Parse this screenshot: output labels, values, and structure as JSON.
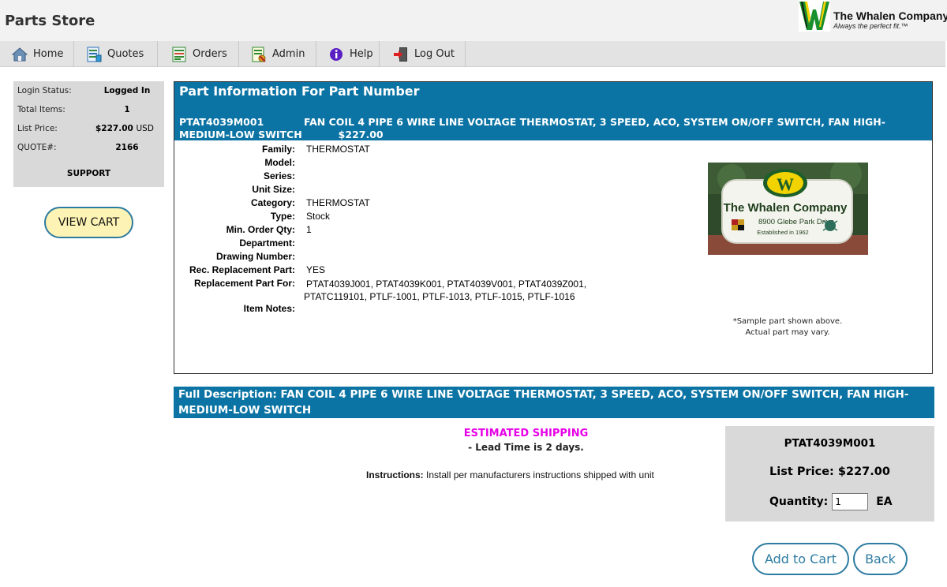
{
  "header": {
    "app_title": "Parts Store",
    "logo_name": "The Whalen Company",
    "logo_tagline": "Always the perfect fit.™",
    "logo_letter": "W"
  },
  "nav": {
    "items": [
      {
        "label": "Home",
        "icon": "home-icon"
      },
      {
        "label": "Quotes",
        "icon": "quotes-icon"
      },
      {
        "label": "Orders",
        "icon": "orders-icon"
      },
      {
        "label": "Admin",
        "icon": "admin-icon"
      },
      {
        "label": "Help",
        "icon": "help-icon"
      },
      {
        "label": "Log Out",
        "icon": "logout-icon"
      }
    ]
  },
  "sidebar": {
    "login_status_label": "Login Status:",
    "login_status_value": "Logged In",
    "total_items_label": "Total Items:",
    "total_items_value": "1",
    "list_price_label": "List Price:",
    "list_price_value": "$227.00",
    "list_price_currency": "USD",
    "quote_label": "QUOTE#:",
    "quote_value": "2166",
    "support_label": "SUPPORT",
    "view_cart_label": "VIEW CART"
  },
  "part": {
    "panel_title": "Part Information For Part Number",
    "part_number": "PTAT4039M001",
    "description": "FAN COIL 4 PIPE 6 WIRE LINE VOLTAGE THERMOSTAT, 3 SPEED, ACO, SYSTEM ON/OFF SWITCH, FAN HIGH-MEDIUM-LOW SWITCH",
    "price": "$227.00",
    "fields": [
      {
        "label": "Family:",
        "value": "THERMOSTAT"
      },
      {
        "label": "Model:",
        "value": ""
      },
      {
        "label": "Series:",
        "value": ""
      },
      {
        "label": "Unit Size:",
        "value": ""
      },
      {
        "label": "Category:",
        "value": "THERMOSTAT"
      },
      {
        "label": "Type:",
        "value": "Stock"
      },
      {
        "label": "Min. Order Qty:",
        "value": "1"
      },
      {
        "label": "Department:",
        "value": ""
      },
      {
        "label": "Drawing Number:",
        "value": ""
      },
      {
        "label": "Rec. Replacement Part:",
        "value": "YES"
      },
      {
        "label": "Replacement Part For:",
        "value": "PTAT4039J001, PTAT4039K001, PTAT4039V001, PTAT4039Z001, PTATC119101, PTLF-1001, PTLF-1013, PTLF-1015, PTLF-1016"
      },
      {
        "label": "Item Notes:",
        "value": ""
      }
    ],
    "image_sign": {
      "name": "The Whalen Company",
      "address": "8900 Glebe Park Drive",
      "established": "Established in 1962"
    },
    "sample_note_line1": "*Sample part shown above.",
    "sample_note_line2": "Actual part may vary."
  },
  "full_description": "Full Description: FAN COIL 4 PIPE 6 WIRE LINE VOLTAGE THERMOSTAT, 3 SPEED, ACO, SYSTEM ON/OFF SWITCH, FAN HIGH-MEDIUM-LOW SWITCH",
  "shipping": {
    "title": "ESTIMATED SHIPPING",
    "lead_time": "- Lead Time is 2 days.",
    "instructions_label": "Instructions:",
    "instructions_text": " Install per manufacturers instructions shipped with unit"
  },
  "order_box": {
    "part_number": "PTAT4039M001",
    "list_price": "List Price: $227.00",
    "quantity_label": "Quantity:",
    "quantity_value": "1",
    "unit": "EA"
  },
  "buttons": {
    "add_to_cart": "Add to Cart",
    "back": "Back"
  },
  "colors": {
    "accent_blue": "#0c74a4",
    "button_border": "#2c7ba0",
    "shipping_magenta": "#e600e6",
    "view_cart_fill": "#fdf3b4",
    "logo_green": "#1a8f2e",
    "logo_yellow": "#f2d300"
  }
}
